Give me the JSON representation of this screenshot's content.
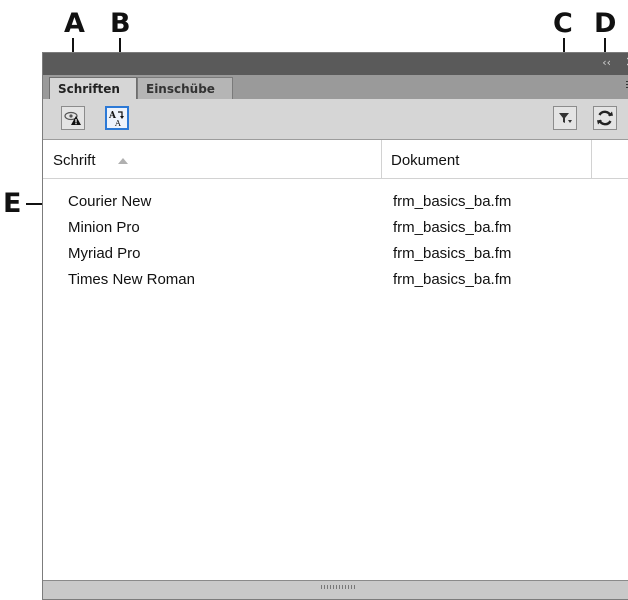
{
  "callouts": {
    "a": "A",
    "b": "B",
    "c": "C",
    "d": "D",
    "e": "E"
  },
  "panel": {
    "tabs": [
      {
        "label": "Schriften",
        "active": true
      },
      {
        "label": "Einschübe",
        "active": false
      }
    ],
    "toolbar": {
      "buttons": [
        {
          "icon": "hide-warning-icon"
        },
        {
          "icon": "font-replace-icon",
          "selected": true
        },
        {
          "icon": "filter-icon"
        },
        {
          "icon": "refresh-icon"
        }
      ]
    },
    "columns": {
      "font": "Schrift",
      "document": "Dokument"
    },
    "rows": [
      {
        "font": "Courier New",
        "document": "frm_basics_ba.fm"
      },
      {
        "font": "Minion Pro",
        "document": "frm_basics_ba.fm"
      },
      {
        "font": "Myriad Pro",
        "document": "frm_basics_ba.fm"
      },
      {
        "font": "Times New Roman",
        "document": "frm_basics_ba.fm"
      }
    ]
  },
  "colors": {
    "selected_border": "#2c79d6",
    "toolbar_bg": "#d6d6d6",
    "titlebar_bg": "#5a5a5a"
  }
}
